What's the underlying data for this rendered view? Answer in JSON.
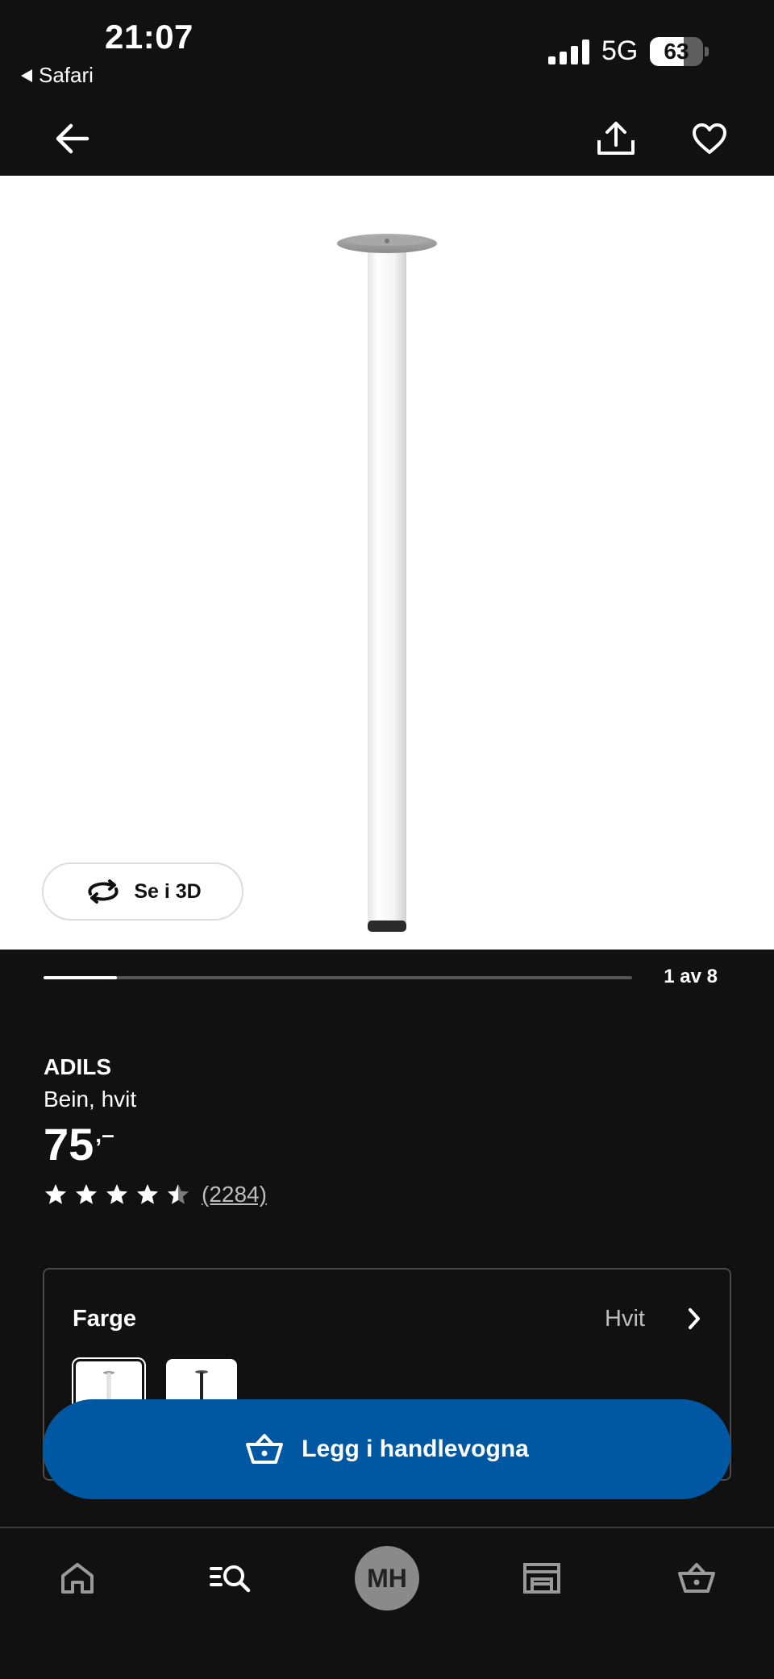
{
  "status_bar": {
    "time": "21:07",
    "back_app": "Safari",
    "network": "5G",
    "battery_level": "63",
    "battery_fraction": 0.63
  },
  "app_bar": {
    "back_icon": "arrow-left-icon",
    "share_icon": "share-icon",
    "favorite_icon": "heart-icon"
  },
  "gallery": {
    "view_3d_label": "Se i 3D",
    "counter": "1 av 8",
    "current": 1,
    "total": 8
  },
  "product": {
    "name": "ADILS",
    "description": "Bein, hvit",
    "price": "75",
    "price_suffix": ",–",
    "rating": 4.5,
    "max_rating": 5,
    "review_count": "(2284)"
  },
  "color_selector": {
    "label": "Farge",
    "selected_value": "Hvit",
    "options": [
      "white",
      "black"
    ]
  },
  "cart": {
    "button_label": "Legg i handlevogna",
    "color": "#0058a3"
  },
  "bottom_nav": {
    "items": [
      "home-icon",
      "search-icon",
      "profile-avatar",
      "store-icon",
      "basket-icon"
    ],
    "avatar_initials": "MH"
  }
}
